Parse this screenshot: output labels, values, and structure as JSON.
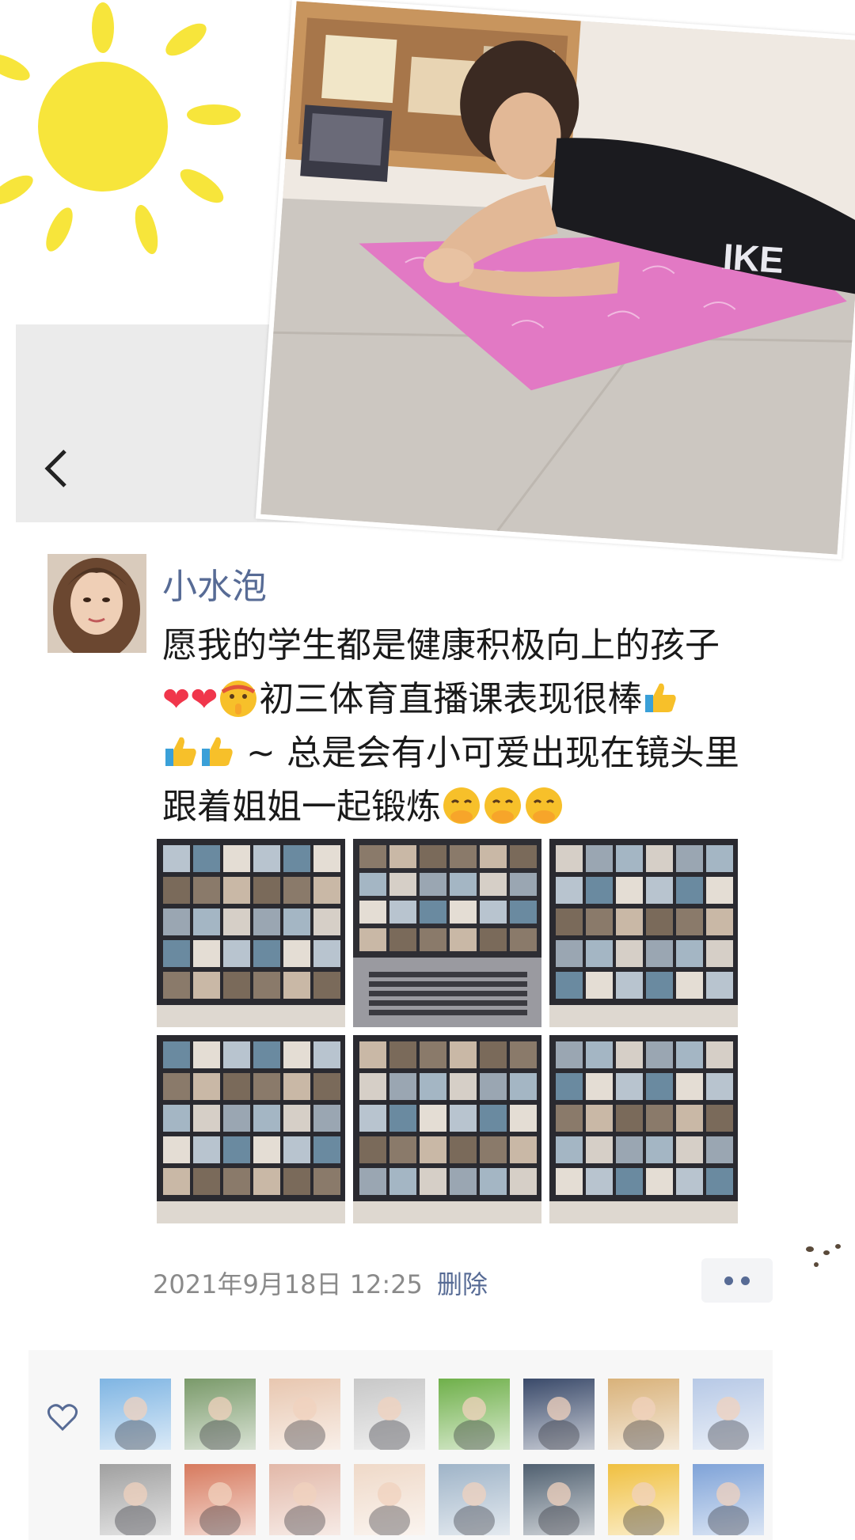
{
  "post": {
    "username": "小水泡",
    "text_line1": "愿我的学生都是健康积极向上的孩子",
    "text_line2": "初三体育直播课表现很棒",
    "text_line3": "~ 总是会有小可爱出现在镜头里",
    "text_line4": "跟着姐姐一起锻炼",
    "heart_emoji": "❤",
    "timestamp": "2021年9月18日 12:25",
    "delete_label": "删除"
  },
  "header_photo": {
    "visible_text": "IKE"
  },
  "likes": {
    "avatar_colors": [
      "#7fb5e3",
      "#7a9a6a",
      "#e8c7b0",
      "#c8c8c8",
      "#6fb04a",
      "#3a4a6a",
      "#d9b27a",
      "#b7c9e6",
      "#a0a0a0",
      "#d77a5e",
      "#e2b8a8",
      "#efd9c8",
      "#9fb4c8",
      "#506070",
      "#f0c040",
      "#7fa3d8"
    ]
  },
  "colors": {
    "link": "#576b95",
    "pink_mat": "#e279c4",
    "text": "#1a1a1a"
  }
}
